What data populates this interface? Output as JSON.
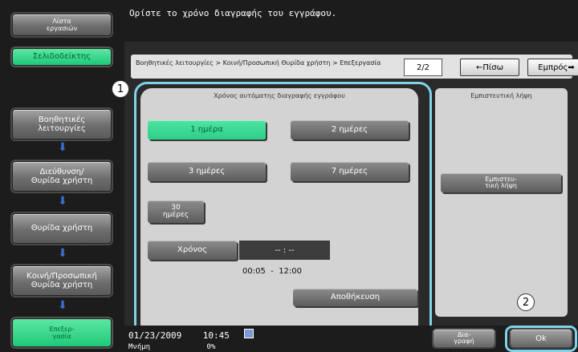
{
  "sidebar": {
    "job_list": "Λίστα\nεργασιών",
    "bookmark": "Σελιδοδείκτης",
    "steps": [
      "Βοηθητικές\nλειτουργίες",
      "Διεύθυνση/\nΘυρίδα χρήστη",
      "Θυρίδα χρήστη",
      "Κοινή/Προσωπική\nΘυρίδα χρήστη"
    ],
    "edit": "Επεξερ-\nγασία",
    "arrow_icon": "arrow-down"
  },
  "header": {
    "message": "Ορίστε το χρόνο διαγραφής του εγγράφου."
  },
  "breadcrumb": {
    "text": "Βοηθητικές λειτουργίες > Κοινή/Προσωπική Θυρίδα χρήστη > Επεξεργασία",
    "page": "2/2",
    "prev": "←Πίσω",
    "next": "Εμπρός➡"
  },
  "time_panel": {
    "title": "Χρόνος αυτόματης διαγραφής εγγράφου",
    "options": [
      "1 ημέρα",
      "2 ημέρες",
      "3 ημέρες",
      "7 ημέρες",
      "30\nημέρες"
    ],
    "selected": "1 ημέρα",
    "time_button": "Χρόνος",
    "time_value": "-- : --",
    "range": "00:05  -  12:00",
    "store": "Αποθήκευση"
  },
  "right_panel": {
    "title": "Εμπιστευτική λήψη",
    "button": "Εμπιστευ-\nτική λήψη"
  },
  "callouts": [
    "1",
    "2"
  ],
  "footer": {
    "datetime": "01/23/2009    10:45",
    "memory": "Μνήμη             0%",
    "delete": "Δια-\nγραφή",
    "ok": "Ok"
  },
  "colors": {
    "accent_green": "#2dcf88",
    "callout_border": "#7fd3ea",
    "arrow_blue": "#3d6fd6"
  }
}
